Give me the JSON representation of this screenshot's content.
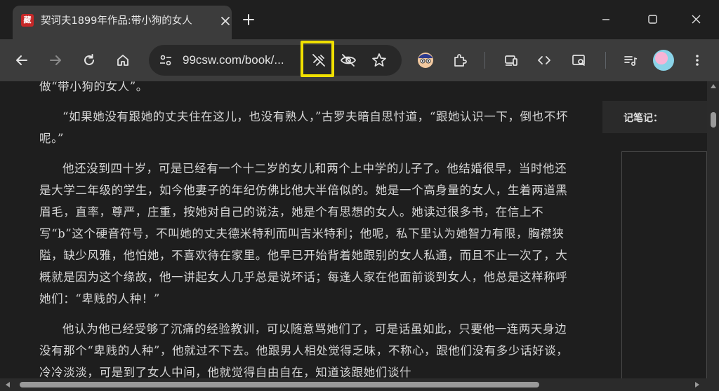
{
  "tab": {
    "favicon_text": "藏",
    "title": "契诃夫1899年作品:带小狗的女人"
  },
  "omnibox": {
    "url": "99csw.com/book/..."
  },
  "article": {
    "paragraphs": [
      "做“带小狗的女人”。",
      "“如果她没有跟她的丈夫住在这儿，也没有熟人，”古罗夫暗自思忖道，“跟她认识一下，倒也不坏呢。”",
      "他还没到四十岁，可是已经有一个十二岁的女儿和两个上中学的儿子了。他结婚很早，当时他还是大学二年级的学生，如今他妻子的年纪仿佛比他大半倍似的。她是一个高身量的女人，生着两道黑眉毛，直率，尊严，庄重，按她对自己的说法，她是个有思想的女人。她读过很多书，在信上不写“b”这个硬音符号，不叫她的丈夫德米特利而叫吉米特利；他呢，私下里认为她智力有限，胸襟狭隘，缺少风雅，他怕她，不喜欢待在家里。他早已开始背着她跟别的女人私通，而且不止一次了，大概就是因为这个缘故，他一讲起女人几乎总是说坏话；每逢人家在他面前谈到女人，他总是这样称呼她们：“卑贱的人种！”",
      "他认为他已经受够了沉痛的经验教训，可以随意骂她们了，可是话虽如此，只要他一连两天身边没有那个“卑贱的人种”，他就过不下去。他跟男人相处觉得乏味，不称心，跟他们没有多少话好谈，冷冷淡淡，可是到了女人中间，他就觉得自由自在，知道该跟她们谈什"
    ]
  },
  "notes": {
    "label": "记笔记："
  },
  "colors": {
    "highlight": "#f0e000",
    "toolbar_bg": "#3c3c3c",
    "page_bg": "#1e1e1e"
  }
}
